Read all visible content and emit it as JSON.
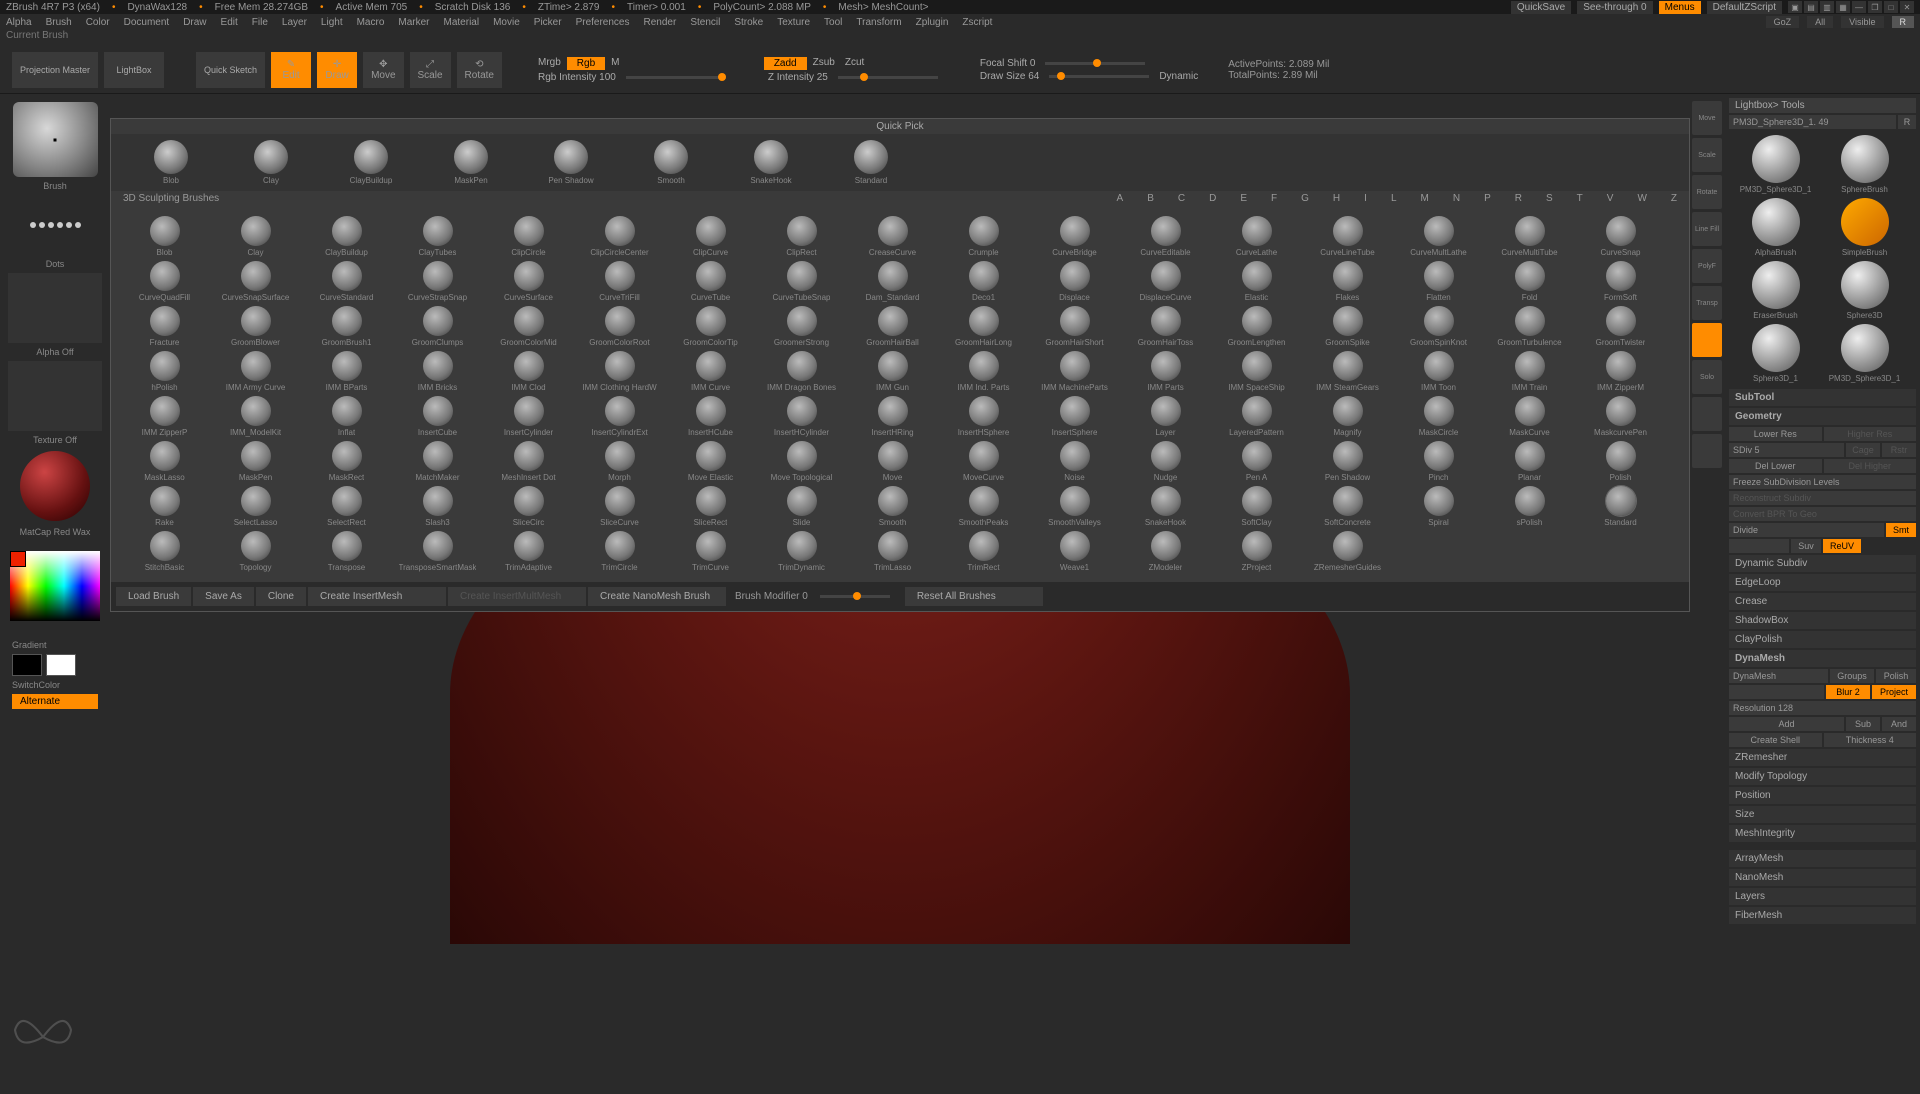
{
  "title": {
    "app": "ZBrush 4R7 P3 (x64)",
    "doc": "DynaWax128",
    "freemem": "Free Mem 28.274GB",
    "activemem": "Active Mem 705",
    "scratch": "Scratch Disk 136",
    "ztime": "ZTime> 2.879",
    "timer": "Timer> 0.001",
    "polycount": "PolyCount> 2.088 MP",
    "mesh": "Mesh> MeshCount>"
  },
  "titlebtns": {
    "quicksave": "QuickSave",
    "seethrough": "See-through  0",
    "menus": "Menus",
    "script": "DefaultZScript"
  },
  "appinfo": "Current Brush",
  "menus": [
    "Alpha",
    "Brush",
    "Color",
    "Document",
    "Draw",
    "Edit",
    "File",
    "Layer",
    "Light",
    "Macro",
    "Marker",
    "Material",
    "Movie",
    "Picker",
    "Preferences",
    "Render",
    "Stencil",
    "Stroke",
    "Texture",
    "Tool",
    "Transform",
    "Zplugin",
    "Zscript"
  ],
  "rmenu": {
    "goz": "GoZ",
    "all": "All",
    "visible": "Visible",
    "r": "R"
  },
  "toolbar": {
    "projection": "Projection Master",
    "lightbox": "LightBox",
    "quicksketch": "Quick Sketch",
    "edit": "Edit",
    "draw": "Draw",
    "move": "Move",
    "scale": "Scale",
    "rotate": "Rotate",
    "mrgb": "Mrgb",
    "rgb": "Rgb",
    "m": "M",
    "rgbint": "Rgb Intensity 100",
    "zadd": "Zadd",
    "zsub": "Zsub",
    "zcut": "Zcut",
    "zint": "Z Intensity 25",
    "focal": "Focal Shift 0",
    "drawsize": "Draw Size 64",
    "dynamic": "Dynamic",
    "ap": "ActivePoints: 2.089 Mil",
    "tp": "TotalPoints: 2.89 Mil"
  },
  "left": {
    "brush": "Brush",
    "dots": "Dots",
    "alpha": "Alpha Off",
    "tex": "Texture Off",
    "mat": "MatCap Red Wax",
    "gradient": "Gradient",
    "switch": "SwitchColor",
    "alternate": "Alternate"
  },
  "rpanel": {
    "lightbox": "Lightbox> Tools",
    "current": "PM3D_Sphere3D_1. 49",
    "r": "R",
    "tools": [
      {
        "n": "PM3D_Sphere3D_1"
      },
      {
        "n": "SphereBrush"
      },
      {
        "n": "AlphaBrush"
      },
      {
        "n": "SimpleBrush"
      },
      {
        "n": "EraserBrush"
      },
      {
        "n": "Sphere3D"
      },
      {
        "n": "Sphere3D_1"
      },
      {
        "n": "PM3D_Sphere3D_1"
      }
    ],
    "subtool": "SubTool",
    "geometry": "Geometry",
    "lowerres": "Lower Res",
    "higherres": "Higher Res",
    "sdiv": "SDiv 5",
    "cage": "Cage",
    "rstr": "Rstr",
    "dellower": "Del Lower",
    "delhigher": "Del Higher",
    "freeze": "Freeze SubDivision Levels",
    "reconstruct": "Reconstruct Subdiv",
    "convert": "Convert BPR To Geo",
    "divide": "Divide",
    "smt": "Smt",
    "suv": "Suv",
    "reuv": "ReUV",
    "dynsub": "Dynamic Subdiv",
    "edgeloop": "EdgeLoop",
    "crease": "Crease",
    "shadowbox": "ShadowBox",
    "claypolish": "ClayPolish",
    "dynamesh": "DynaMesh",
    "dynamesh2": "DynaMesh",
    "groups": "Groups",
    "polish": "Polish",
    "blur": "Blur 2",
    "project": "Project",
    "res": "Resolution 128",
    "add": "Add",
    "sub": "Sub",
    "and": "And",
    "createshell": "Create Shell",
    "thickness": "Thickness 4",
    "zremesher": "ZRemesher",
    "modtopo": "Modify Topology",
    "position": "Position",
    "size": "Size",
    "meshint": "MeshIntegrity",
    "arraymesh": "ArrayMesh",
    "nanomesh": "NanoMesh",
    "layers": "Layers",
    "fibermesh": "FiberMesh"
  },
  "rtools": [
    "Move",
    "Scale",
    "Rotate",
    "Line Fill",
    "PolyF",
    "",
    "Transp",
    "",
    "Solo",
    "",
    ""
  ],
  "brushpanel": {
    "quickpick": "Quick Pick",
    "qp": [
      "Blob",
      "Clay",
      "ClayBuildup",
      "MaskPen",
      "Pen Shadow",
      "Smooth",
      "SnakeHook",
      "Standard"
    ],
    "sculpting": "3D Sculpting Brushes",
    "az": [
      "A",
      "B",
      "C",
      "D",
      "E",
      "F",
      "G",
      "H",
      "I",
      "L",
      "M",
      "N",
      "P",
      "R",
      "S",
      "T",
      "V",
      "W",
      "Z"
    ],
    "brushes": [
      "Blob",
      "Clay",
      "ClayBuildup",
      "ClayTubes",
      "ClipCircle",
      "ClipCircleCenter",
      "ClipCurve",
      "ClipRect",
      "CreaseCurve",
      "Crumple",
      "CurveBridge",
      "CurveEditable",
      "CurveLathe",
      "CurveLineTube",
      "CurveMultLathe",
      "CurveMultiTube",
      "CurveSnap",
      "CurveQuadFill",
      "CurveSnapSurface",
      "CurveStandard",
      "CurveStrapSnap",
      "CurveSurface",
      "CurveTriFill",
      "CurveTube",
      "CurveTubeSnap",
      "Dam_Standard",
      "Deco1",
      "Displace",
      "DisplaceCurve",
      "Elastic",
      "Flakes",
      "Flatten",
      "Fold",
      "FormSoft",
      "Fracture",
      "GroomBlower",
      "GroomBrush1",
      "GroomClumps",
      "GroomColorMid",
      "GroomColorRoot",
      "GroomColorTip",
      "GroomerStrong",
      "GroomHairBall",
      "GroomHairLong",
      "GroomHairShort",
      "GroomHairToss",
      "GroomLengthen",
      "GroomSpike",
      "GroomSpinKnot",
      "GroomTurbulence",
      "GroomTwister",
      "hPolish",
      "IMM Army Curve",
      "IMM BParts",
      "IMM Bricks",
      "IMM Clod",
      "IMM Clothing HardW",
      "IMM Curve",
      "IMM Dragon Bones",
      "IMM Gun",
      "IMM Ind. Parts",
      "IMM MachineParts",
      "IMM Parts",
      "IMM SpaceShip",
      "IMM SteamGears",
      "IMM Toon",
      "IMM Train",
      "IMM ZipperM",
      "IMM ZipperP",
      "IMM_ModelKit",
      "Inflat",
      "InsertCube",
      "InsertCylinder",
      "InsertCylindrExt",
      "InsertHCube",
      "InsertHCylinder",
      "InsertHRing",
      "InsertHSphere",
      "InsertSphere",
      "Layer",
      "LayeredPattern",
      "Magnify",
      "MaskCircle",
      "MaskCurve",
      "MaskcurvePen",
      "MaskLasso",
      "MaskPen",
      "MaskRect",
      "MatchMaker",
      "MeshInsert Dot",
      "Morph",
      "Move Elastic",
      "Move Topological",
      "Move",
      "MoveCurve",
      "Noise",
      "Nudge",
      "Pen A",
      "Pen Shadow",
      "Pinch",
      "Planar",
      "Polish",
      "Rake",
      "SelectLasso",
      "SelectRect",
      "Slash3",
      "SliceCirc",
      "SliceCurve",
      "SliceRect",
      "Slide",
      "Smooth",
      "SmoothPeaks",
      "SmoothValleys",
      "SnakeHook",
      "SoftClay",
      "SoftConcrete",
      "Spiral",
      "sPolish",
      "Standard",
      "StitchBasic",
      "Topology",
      "Transpose",
      "TransposeSmartMask",
      "TrimAdaptive",
      "TrimCircle",
      "TrimCurve",
      "TrimDynamic",
      "TrimLasso",
      "TrimRect",
      "Weave1",
      "ZModeler",
      "ZProject",
      "ZRemesherGuides"
    ],
    "load": "Load Brush",
    "saveas": "Save As",
    "clone": "Clone",
    "cim": "Create InsertMesh",
    "cimm": "Create InsertMultMesh",
    "cnm": "Create NanoMesh Brush",
    "bm": "Brush Modifier 0",
    "reset": "Reset All Brushes"
  }
}
